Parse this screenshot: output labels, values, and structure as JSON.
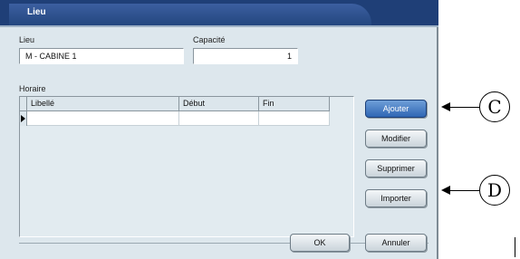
{
  "window": {
    "title": "Lieu"
  },
  "fields": {
    "lieu_label": "Lieu",
    "lieu_value": "M - CABINE 1",
    "capacite_label": "Capacité",
    "capacite_value": "1"
  },
  "horaire": {
    "label": "Horaire",
    "columns": [
      "Libellé",
      "Début",
      "Fin"
    ]
  },
  "buttons": {
    "ajouter": "Ajouter",
    "modifier": "Modifier",
    "supprimer": "Supprimer",
    "importer": "Importer",
    "ok": "OK",
    "annuler": "Annuler"
  },
  "callouts": {
    "c": "C",
    "d": "D"
  },
  "colors": {
    "title_bar": "#1f3f77",
    "dialog_bg": "#dde7ed",
    "primary_button": "#2f66b4"
  }
}
